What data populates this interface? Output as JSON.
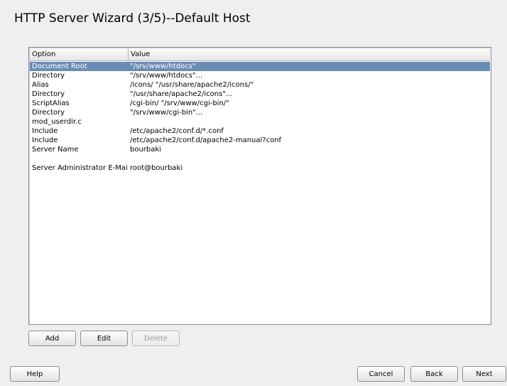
{
  "title": "HTTP Server Wizard (3/5)--Default Host",
  "table": {
    "columns": [
      "Option",
      "Value"
    ],
    "rows": [
      {
        "option": "Document Root",
        "value": "\"/srv/www/htdocs\"",
        "selected": true
      },
      {
        "option": "Directory",
        "value": "\"/srv/www/htdocs\"..."
      },
      {
        "option": "Alias",
        "value": "/icons/ \"/usr/share/apache2/icons/\""
      },
      {
        "option": "Directory",
        "value": "\"/usr/share/apache2/icons\"..."
      },
      {
        "option": "ScriptAlias",
        "value": "/cgi-bin/ \"/srv/www/cgi-bin/\""
      },
      {
        "option": "Directory",
        "value": "\"/srv/www/cgi-bin\"..."
      },
      {
        "option": "mod_userdir.c",
        "value": ""
      },
      {
        "option": "Include",
        "value": "/etc/apache2/conf.d/*.conf"
      },
      {
        "option": "Include",
        "value": "/etc/apache2/conf.d/apache2-manual?conf"
      },
      {
        "option": "Server Name",
        "value": "bourbaki"
      },
      {
        "option": "",
        "value": ""
      },
      {
        "option": "Server Administrator E-Mail",
        "value": "root@bourbaki"
      }
    ]
  },
  "buttons": {
    "add": "Add",
    "edit": "Edit",
    "delete": "Delete",
    "help": "Help",
    "cancel": "Cancel",
    "back": "Back",
    "next": "Next"
  },
  "colors": {
    "selection": "#6a8db5",
    "background": "#efefef"
  }
}
